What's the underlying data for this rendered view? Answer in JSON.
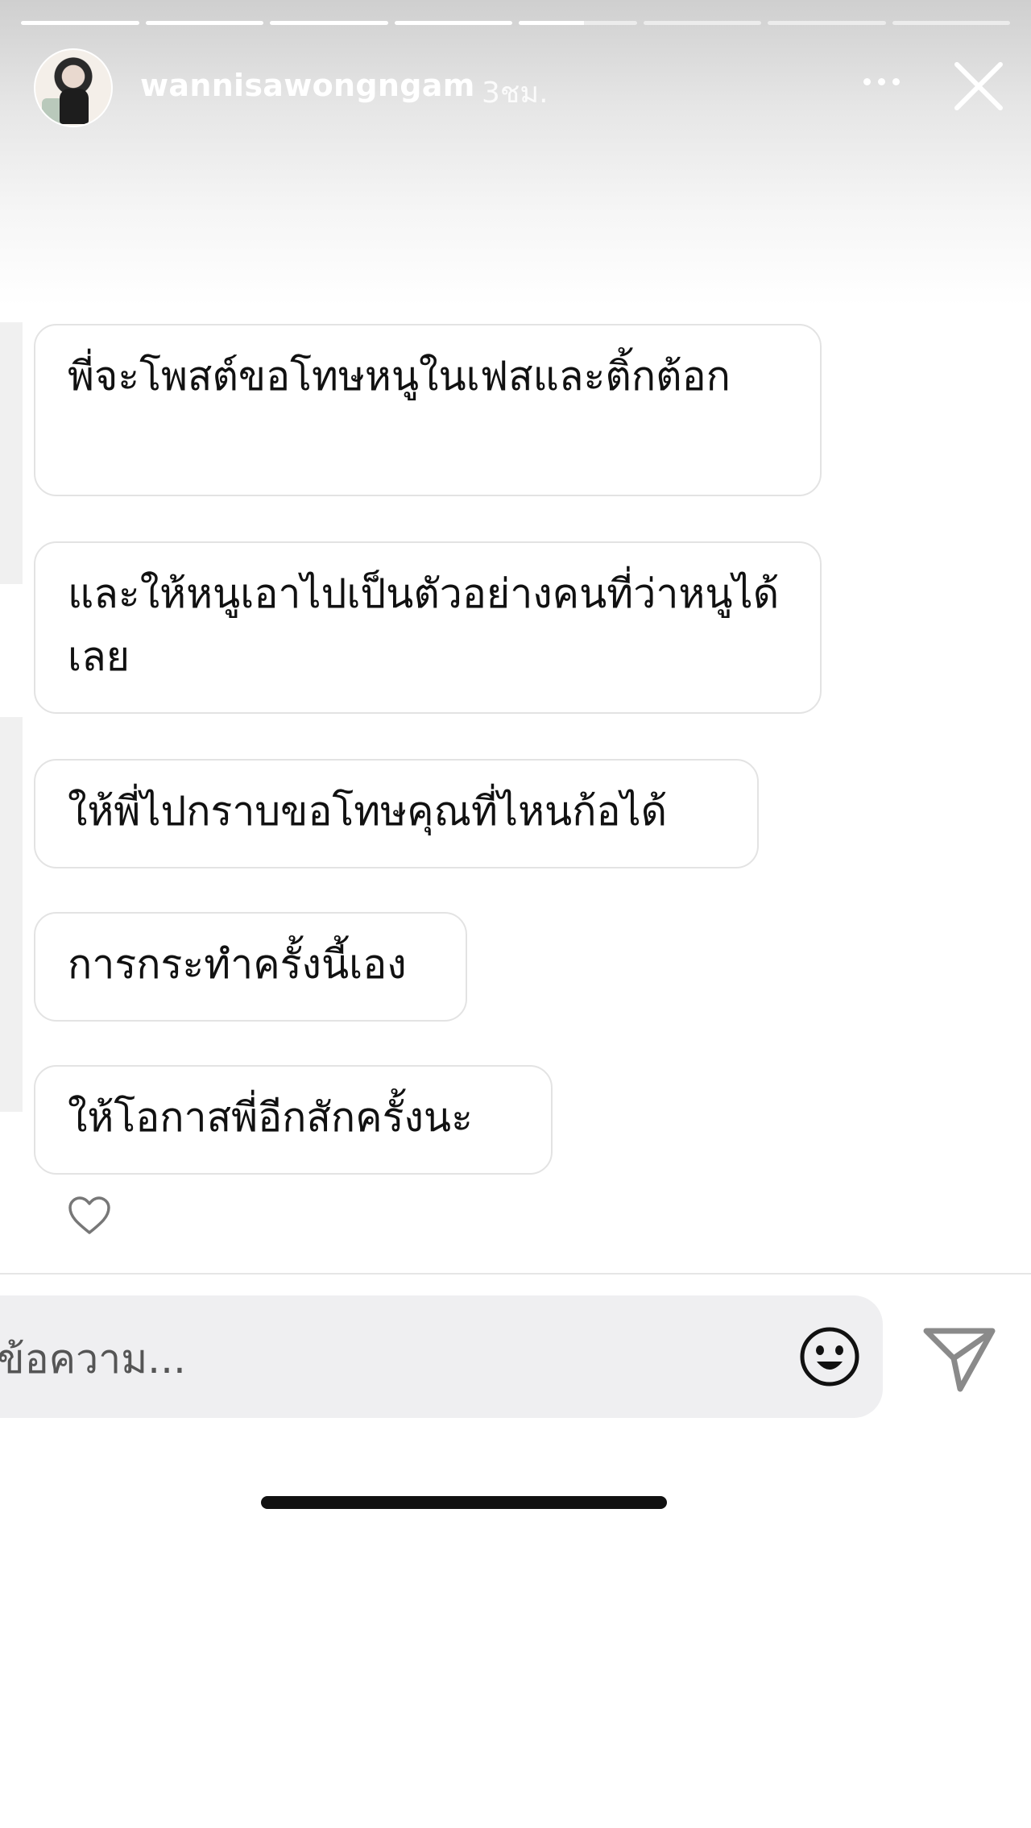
{
  "story": {
    "progress": [
      1,
      1,
      1,
      1,
      0.55,
      0,
      0,
      0
    ],
    "username": "wannisawongngam",
    "timestamp": "3ชม."
  },
  "messages": [
    {
      "text": "พี่จะโพสต์ขอโทษหนูในเฟสและติ้กต้อก"
    },
    {
      "text": "และให้หนูเอาไปเป็นตัวอย่างคนที่ว่าหนูได้เลย"
    },
    {
      "text": "ให้พี่ไปกราบขอโทษคุณที่ไหนก้อได้"
    },
    {
      "text": "การกระทำครั้งนี้เอง"
    },
    {
      "text": "ให้โอกาสพี่อีกสักครั้งนะ"
    }
  ],
  "composer": {
    "placeholder": "งข้อความ..."
  },
  "icons": {
    "more": "more-horizontal-icon",
    "close": "close-icon",
    "like": "heart-icon",
    "emoji": "emoji-icon",
    "send": "send-icon"
  }
}
